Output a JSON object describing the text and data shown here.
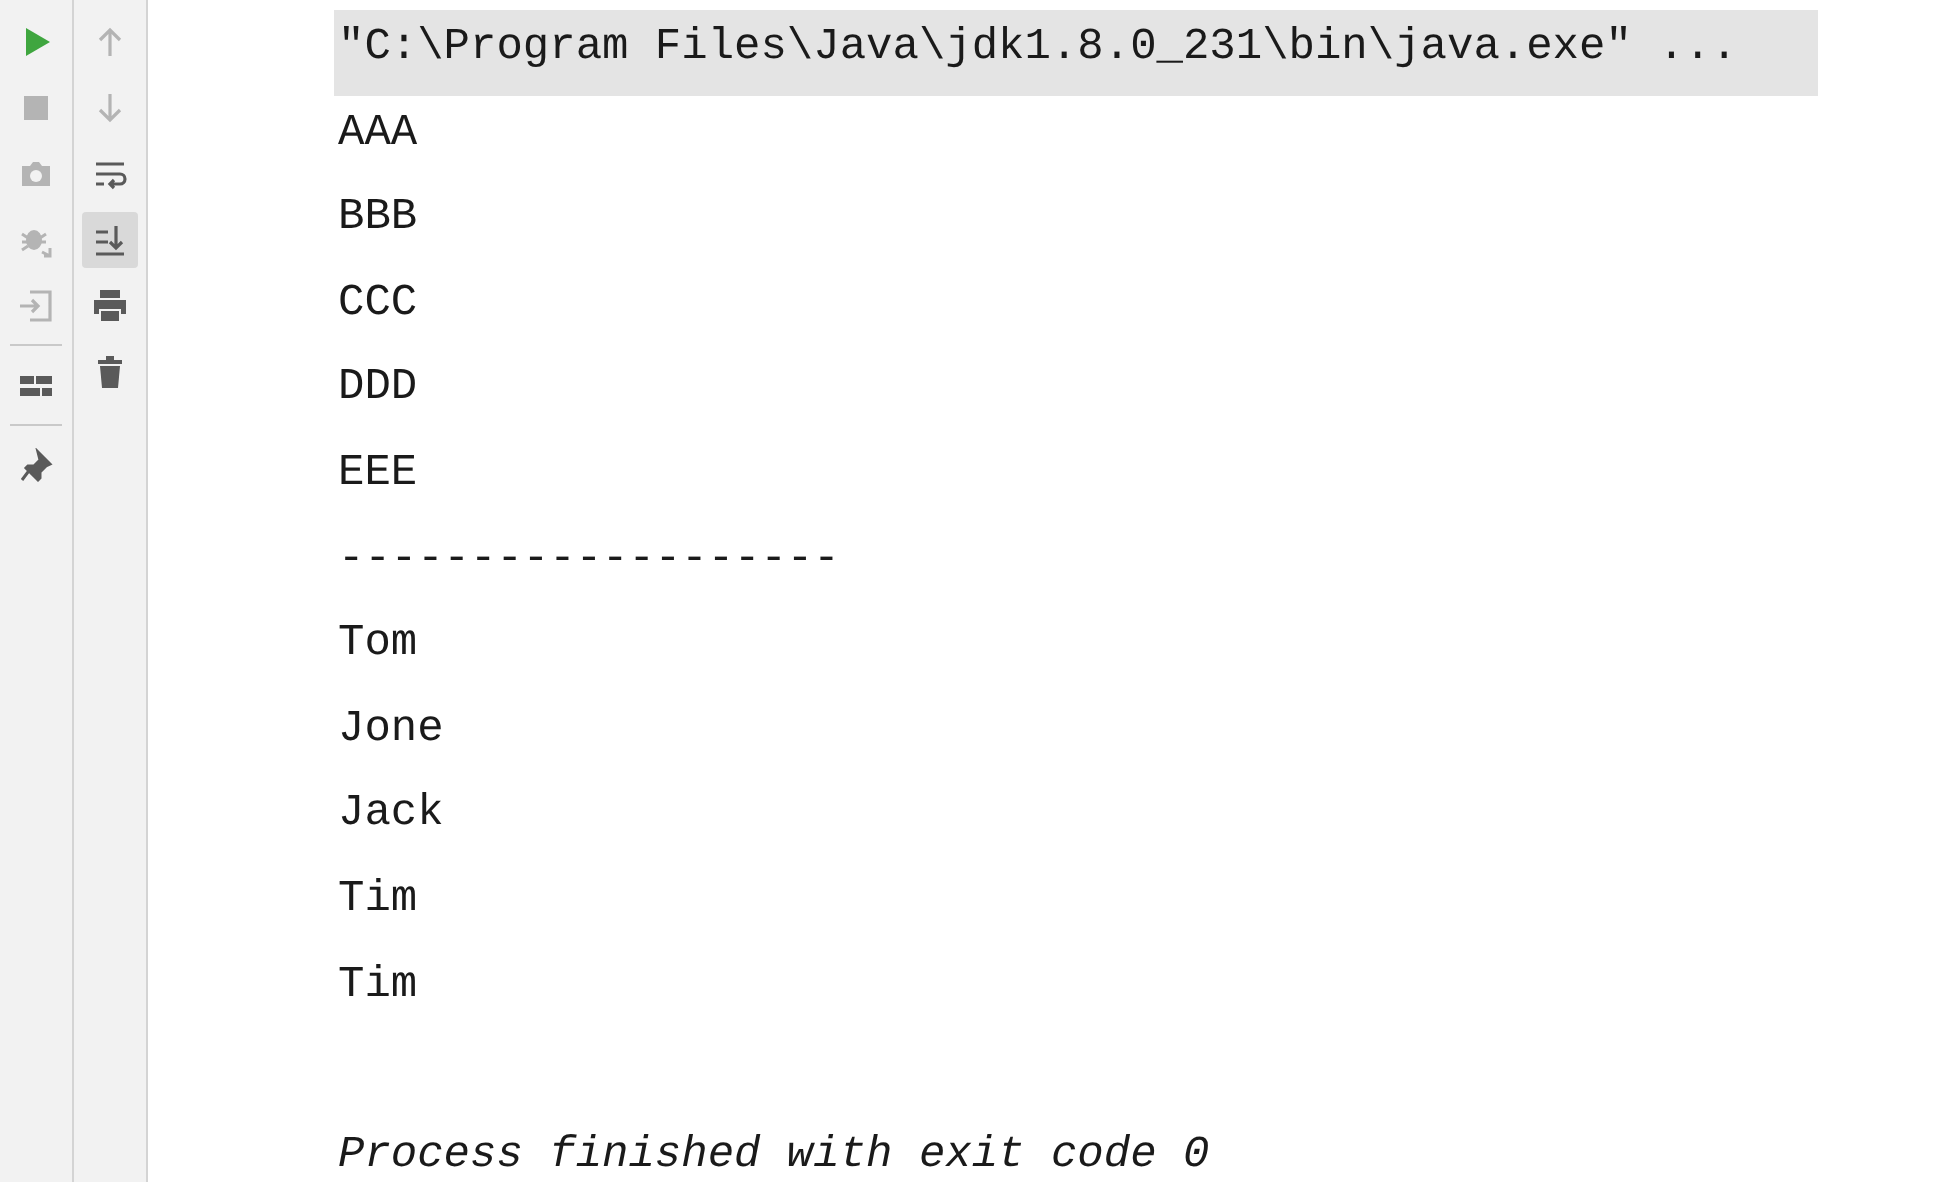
{
  "left_toolbar": [
    {
      "kind": "run",
      "enabled": true
    },
    {
      "kind": "stop",
      "enabled": false
    },
    {
      "kind": "camera",
      "enabled": false
    },
    {
      "kind": "bug",
      "enabled": false
    },
    {
      "kind": "enter",
      "enabled": false
    },
    {
      "kind": "separator"
    },
    {
      "kind": "layout",
      "enabled": true
    },
    {
      "kind": "separator"
    },
    {
      "kind": "pin",
      "enabled": true
    }
  ],
  "right_toolbar": [
    {
      "kind": "up",
      "enabled": false,
      "selected": false
    },
    {
      "kind": "down",
      "enabled": false,
      "selected": false
    },
    {
      "kind": "wrap",
      "enabled": true,
      "selected": false
    },
    {
      "kind": "scroll-end",
      "enabled": true,
      "selected": true
    },
    {
      "kind": "print",
      "enabled": true,
      "selected": false
    },
    {
      "kind": "trash",
      "enabled": true,
      "selected": false
    }
  ],
  "console_lines": [
    {
      "kind": "command",
      "text": "\"C:\\Program Files\\Java\\jdk1.8.0_231\\bin\\java.exe\" ..."
    },
    {
      "kind": "output",
      "text": "AAA"
    },
    {
      "kind": "output",
      "text": "BBB"
    },
    {
      "kind": "output",
      "text": "CCC"
    },
    {
      "kind": "output",
      "text": "DDD"
    },
    {
      "kind": "output",
      "text": "EEE"
    },
    {
      "kind": "output",
      "text": "-------------------"
    },
    {
      "kind": "output",
      "text": "Tom"
    },
    {
      "kind": "output",
      "text": "Jone"
    },
    {
      "kind": "output",
      "text": "Jack"
    },
    {
      "kind": "output",
      "text": "Tim"
    },
    {
      "kind": "output",
      "text": "Tim"
    },
    {
      "kind": "exit",
      "text": "Process finished with exit code 0"
    }
  ]
}
